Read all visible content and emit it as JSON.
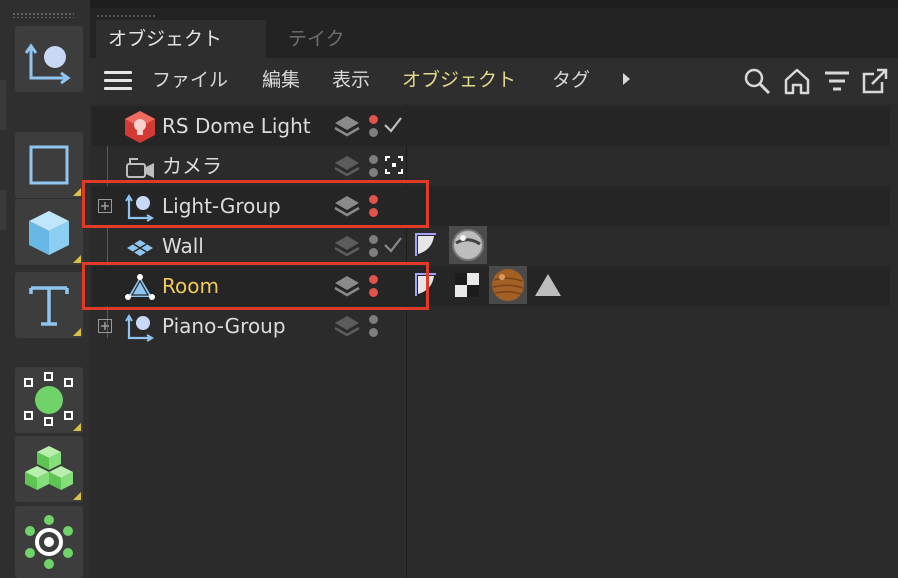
{
  "tabs": [
    {
      "label": "オブジェクト",
      "active": true
    },
    {
      "label": "テイク",
      "active": false
    }
  ],
  "menu": {
    "items": [
      "ファイル",
      "編集",
      "表示",
      "オブジェクト",
      "タグ"
    ],
    "highlighted": "オブジェクト",
    "icons": [
      "hamburger-menu-icon",
      "more-arrow-icon",
      "search-icon",
      "home-icon",
      "filter-icon",
      "open-new-window-icon"
    ]
  },
  "toolbar": {
    "tools": [
      "null-object-tool-icon",
      "spline-rectangle-tool-icon",
      "cube-tool-icon",
      "text-tool-icon",
      "subdivision-tool-icon",
      "cloner-tool-icon",
      "deformer-tool-icon"
    ]
  },
  "objects": [
    {
      "name": "RS Dome Light",
      "icon": "rs-dome-light-icon",
      "dots": [
        "red",
        "gray"
      ],
      "check": "checkmark"
    },
    {
      "name": "カメラ",
      "icon": "camera-icon",
      "dots": [
        "gray",
        "gray"
      ],
      "check": "target-tag"
    },
    {
      "name": "Light-Group",
      "icon": "null-group-icon",
      "dots": [
        "red",
        "red"
      ],
      "expandable": true,
      "highlighted": true
    },
    {
      "name": "Wall",
      "icon": "plane-icon",
      "dots": [
        "gray",
        "gray"
      ],
      "check": "checkmark",
      "tags": [
        "phong-tag-icon",
        "material-wall-icon"
      ]
    },
    {
      "name": "Room",
      "icon": "polygon-object-icon",
      "dots": [
        "red",
        "red"
      ],
      "selected": true,
      "highlighted": true,
      "tags": [
        "phong-tag-icon",
        "uvw-tag-icon",
        "material-wood-icon",
        "selection-tag-icon"
      ]
    },
    {
      "name": "Piano-Group",
      "icon": "null-group-icon",
      "dots": [
        "gray",
        "gray"
      ],
      "expandable": true
    }
  ],
  "colors": {
    "highlight_box": "#e23a28",
    "selected_text": "#f0c95c",
    "menu_highlight": "#e3d98a",
    "enabled_dot": "#e0524a"
  }
}
